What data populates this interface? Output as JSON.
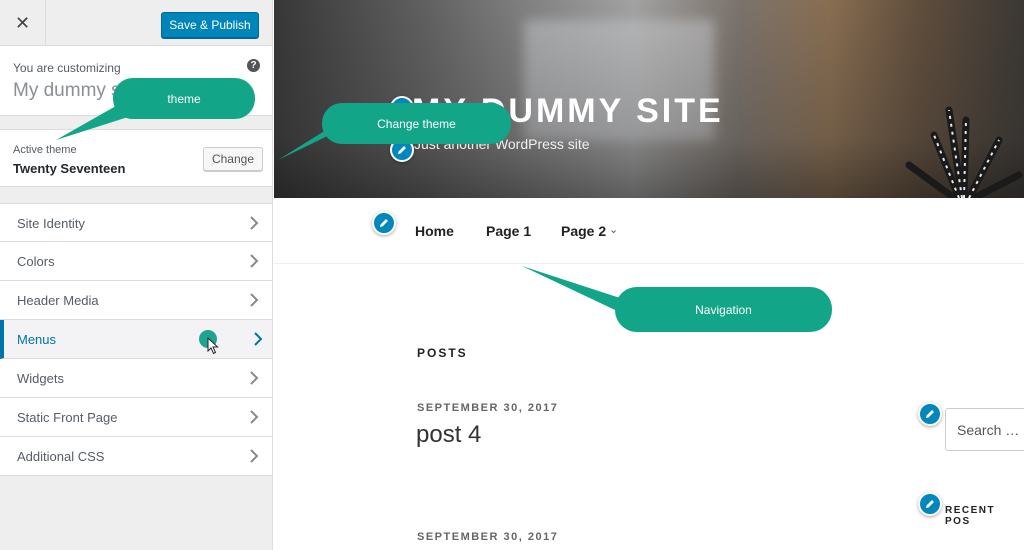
{
  "sidebar": {
    "close_glyph": "✕",
    "publish_label": "Save & Publish",
    "customizing_label": "You are customizing",
    "site_name": "My dummy site",
    "help_glyph": "?",
    "active_theme_label": "Active theme",
    "active_theme_name": "Twenty Seventeen",
    "change_label": "Change",
    "active_item": "Menus",
    "items": [
      {
        "label": "Site Identity"
      },
      {
        "label": "Colors"
      },
      {
        "label": "Header Media"
      },
      {
        "label": "Menus"
      },
      {
        "label": "Widgets"
      },
      {
        "label": "Static Front Page"
      },
      {
        "label": "Additional CSS"
      }
    ]
  },
  "preview": {
    "site_title": "MY DUMMY SITE",
    "tagline": "Just another WordPress site",
    "nav": [
      {
        "label": "Home"
      },
      {
        "label": "Page 1"
      },
      {
        "label": "Page 2"
      }
    ],
    "nav_caret": "⌄",
    "posts_heading": "POSTS",
    "posts": [
      {
        "date": "SEPTEMBER 30, 2017",
        "title": "post 4"
      },
      {
        "date": "SEPTEMBER 30, 2017"
      }
    ],
    "search_placeholder": "Search …",
    "recent_posts_heading": "RECENT POS"
  },
  "callouts": {
    "theme": "theme",
    "change_theme": "Change theme",
    "navigation": "Navigation"
  },
  "colors": {
    "accent_blue": "#0073aa",
    "publish_button": "#0085ba",
    "callout_green": "#13a588"
  }
}
